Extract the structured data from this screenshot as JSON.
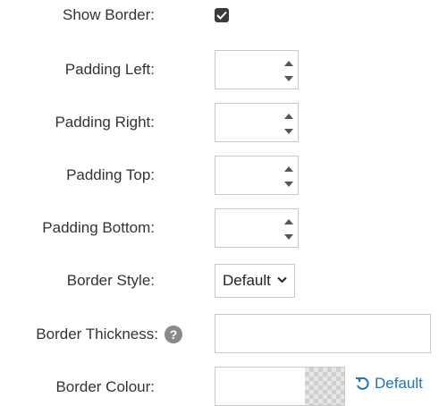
{
  "form": {
    "show_border": {
      "label": "Show Border:",
      "checked": true
    },
    "padding_left": {
      "label": "Padding Left:",
      "value": ""
    },
    "padding_right": {
      "label": "Padding Right:",
      "value": ""
    },
    "padding_top": {
      "label": "Padding Top:",
      "value": ""
    },
    "padding_bottom": {
      "label": "Padding Bottom:",
      "value": ""
    },
    "border_style": {
      "label": "Border Style:",
      "selected": "Default"
    },
    "border_thickness": {
      "label": "Border Thickness:",
      "value": "",
      "help_icon": "question-circle-icon"
    },
    "border_colour": {
      "label": "Border Colour:",
      "value": "",
      "reset_label": "Default",
      "reset_icon": "undo-icon"
    }
  },
  "colors": {
    "text": "#333333",
    "link": "#1e74b8",
    "border": "#c9c9c9",
    "checkbox": "#3b3b3b",
    "help_icon": "#8a8a8a"
  }
}
